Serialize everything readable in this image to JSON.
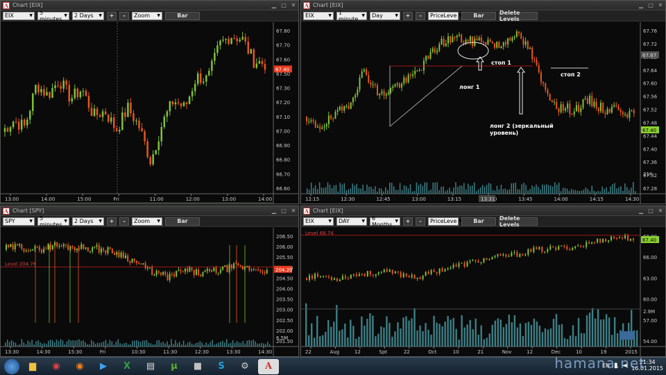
{
  "windows": [
    {
      "id": "w1",
      "title": "Chart [EIX]",
      "symbol": "EIX",
      "interval": "5 minutes",
      "range": "2 Days",
      "plus": "+",
      "minus": "-",
      "mode": "Zoom",
      "chart_type_btn": "Bar",
      "price_ticks": [
        "67.80",
        "67.70",
        "67.60",
        "67.50",
        "67.30",
        "67.20",
        "67.10",
        "67.00",
        "66.90",
        "66.80",
        "66.70",
        "66.60"
      ],
      "last_price": "67.40",
      "time_ticks": [
        "13:00",
        "14:00",
        "15:00",
        "Fri",
        "11:00",
        "12:00",
        "13:00",
        "14:00"
      ]
    },
    {
      "id": "w2",
      "title": "Chart [EIX]",
      "symbol": "EIX",
      "interval": "1 minute",
      "range": "Day",
      "plus": "+",
      "minus": "-",
      "mode": "PriceLeve",
      "chart_type_btn": "Bar",
      "delete_levels": "Delete Levels",
      "price_ticks": [
        "67.76",
        "67.72",
        "67.68",
        "67.64",
        "67.60",
        "67.56",
        "67.52",
        "67.48",
        "67.44",
        "67.40",
        "67.36",
        "67.32",
        "67.28"
      ],
      "last_price": "67.40",
      "mid_price": "67.67",
      "volume_label": "21K",
      "time_ticks": [
        "12:15",
        "12:30",
        "12:45",
        "13:00",
        "13:15",
        "13:30",
        "13:45",
        "14:00",
        "14:15",
        "14:30"
      ],
      "time_highlight": "13:31",
      "annotations": {
        "long1": "лонг 1",
        "stop1": "стоп 1",
        "stop2": "стоп 2",
        "long2_line1": "лонг 2 (зеркальный",
        "long2_line2": "уровень)"
      }
    },
    {
      "id": "w3",
      "title": "Chart [SPY]",
      "symbol": "SPY",
      "interval": "5 minutes",
      "range": "2 Days",
      "plus": "+",
      "minus": "-",
      "mode": "Zoom",
      "chart_type_btn": "Bar",
      "level_label": "Level 204.76",
      "price_ticks": [
        "206.50",
        "206.00",
        "205.50",
        "205.00",
        "204.50",
        "204.00",
        "203.50",
        "203.00",
        "202.50",
        "202.00",
        "201.50"
      ],
      "last_price": "204.20",
      "volume_label": "6.5M",
      "time_ticks": [
        "13:30",
        "14:30",
        "15:30",
        "Fri",
        "10:30",
        "11:30",
        "12:30",
        "13:30",
        "14:30"
      ]
    },
    {
      "id": "w4",
      "title": "Chart [EIX]",
      "symbol": "EIX",
      "interval": "DAY",
      "range": "6 Months",
      "plus": "+",
      "minus": "-",
      "mode": "PriceLeve",
      "chart_type_btn": "Bar",
      "delete_levels": "Delete Levels",
      "level_label": "Level 68.74",
      "price_ticks": [
        "69.00",
        "66.00",
        "63.00",
        "60.00",
        "57.00",
        "54.00"
      ],
      "last_price": "67.40",
      "volume_label": "2.9M",
      "time_ticks": [
        "22",
        "Aug",
        "12",
        "Spt",
        "22",
        "Oct",
        "10",
        "21",
        "Nov",
        "12",
        "Dec",
        "10",
        "19",
        "2015"
      ]
    }
  ],
  "taskbar": {
    "icons": [
      "folder",
      "chrome",
      "firefox",
      "media",
      "excel",
      "film",
      "utorrent",
      "app",
      "skype",
      "tools",
      "chart"
    ],
    "lang": "EN",
    "time": "21:34",
    "date": "16.01.2015",
    "watermark": "hamana.net"
  },
  "colors": {
    "up": "#7fc23a",
    "down": "#e8561e",
    "volume": "#3d7f86",
    "level": "#a01818",
    "badge": "#e83a1e"
  }
}
